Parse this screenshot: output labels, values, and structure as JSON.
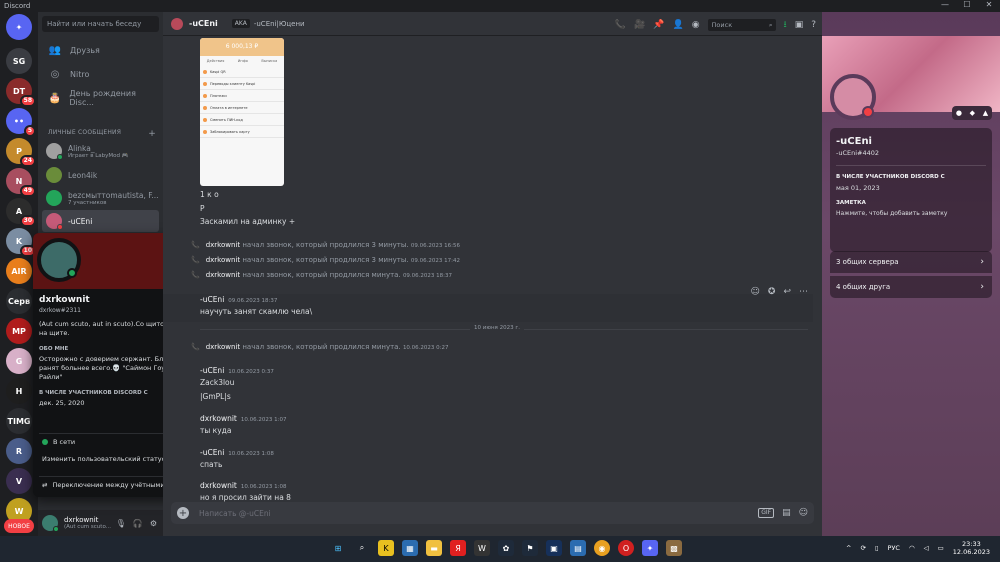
{
  "window": {
    "title": "Discord",
    "minimize": "—",
    "maximize": "☐",
    "close": "✕"
  },
  "rail": {
    "servers": [
      {
        "label": "✦",
        "color": "#5865f2",
        "badge": ""
      },
      {
        "label": "SG",
        "color": "#3a3c42",
        "badge": ""
      },
      {
        "label": "DT",
        "color": "#8a2b2b",
        "badge": "58"
      },
      {
        "label": "••",
        "color": "#5865f2",
        "badge": "5"
      },
      {
        "label": "P",
        "color": "#c48a2c",
        "badge": "24"
      },
      {
        "label": "N",
        "color": "#a84e5f",
        "badge": "49"
      },
      {
        "label": "A",
        "color": "#2c2c2c",
        "badge": "30"
      },
      {
        "label": "K",
        "color": "#7b8da2",
        "badge": "10"
      },
      {
        "label": "AIR",
        "color": "#e87e1c",
        "badge": ""
      },
      {
        "label": "Серв",
        "color": "#2b2d31",
        "badge": ""
      },
      {
        "label": "MP",
        "color": "#b01c1c",
        "badge": ""
      },
      {
        "label": "G",
        "color": "#d8b0c8",
        "badge": ""
      },
      {
        "label": "H",
        "color": "#1e1e1e",
        "badge": ""
      },
      {
        "label": "TIMG",
        "color": "#2b2d31",
        "badge": ""
      },
      {
        "label": "R",
        "color": "#4a5d8a",
        "badge": ""
      },
      {
        "label": "V",
        "color": "#3a2e50",
        "badge": ""
      },
      {
        "label": "W",
        "color": "#c0a020",
        "badge": ""
      }
    ],
    "new_label": "НОВОЕ"
  },
  "sidebar": {
    "search_label": "Найти или начать беседу",
    "nav": [
      {
        "label": "Друзья",
        "icon": "👥"
      },
      {
        "label": "Nitro",
        "icon": "◎"
      },
      {
        "label": "День рождения Disc...",
        "icon": "🎂"
      }
    ],
    "dm_header": "ЛИЧНЫЕ СООБЩЕНИЯ",
    "dm_add": "+",
    "dms": [
      {
        "name": "Alinka_",
        "sub": "Играет в LabyMod 🎮",
        "color": "#a0a0a0"
      },
      {
        "name": "Leon4ik",
        "sub": "",
        "color": "#6a8c3a"
      },
      {
        "name": "bezсмыттоmautista, F...",
        "sub": "7 участников",
        "color": "#23a55a"
      },
      {
        "name": "-uCEni",
        "sub": "",
        "color": "#c55a78"
      }
    ]
  },
  "user_panel": {
    "name": "dxrkownit",
    "status": "(Aut cum scuto..."
  },
  "popout": {
    "name": "dxrkownit",
    "tag": "dxrkow#2311",
    "bio": "(Aut cum scuto, aut in scuto).Со щитом или на щите.",
    "about_title": "ОБО МНЕ",
    "about_text": "Осторожно с доверием сержант. Близкие ранят больнее всего.💀 \"Саймон Гоуст Райли\"",
    "member_title": "В ЧИСЛЕ УЧАСТНИКОВ DISCORD С",
    "member_since": "дек. 25, 2020",
    "status_label": "В сети",
    "custom_status": "Изменить пользовательский статус",
    "switch_accounts": "Переключение между учётными ...",
    "arrow": "›"
  },
  "chat": {
    "header_name": "-uCEni",
    "aka_label": "AKA",
    "aka_name": "-uCEni|Юцени",
    "search_placeholder": "Поиск",
    "phone_card": {
      "balance": "6 000,13 ₽",
      "tabs": [
        "Действия",
        "Инфо",
        "Выписка"
      ],
      "lines": [
        "Kaspi QR",
        "Переводы клиенту Kaspi",
        "Платежи",
        "Оплата в интернете",
        "Сменить ПИН-код",
        "Заблокировать карту"
      ]
    },
    "lines": [
      {
        "text": "1 к о"
      },
      {
        "text": "Р"
      },
      {
        "text": "Заскамил на админку +"
      }
    ],
    "calls": [
      {
        "user": "dxrkownit",
        "text": "начал звонок, который продлился 3 минуты.",
        "ts": "09.06.2023 16:56"
      },
      {
        "user": "dxrkownit",
        "text": "начал звонок, который продлился 3 минуты.",
        "ts": "09.06.2023 17:42"
      },
      {
        "user": "dxrkownit",
        "text": "начал звонок, который продлился минута.",
        "ts": "09.06.2023 18:37"
      }
    ],
    "msg1": {
      "author": "-uCEni",
      "ts": "09.06.2023 18:37",
      "text": "научуть занят скамлю чела\\"
    },
    "date_divider": "10 июня 2023 г.",
    "call4": {
      "user": "dxrkownit",
      "text": "начал звонок, который продлился минута.",
      "ts": "10.06.2023 0:27"
    },
    "msg2": {
      "author": "-uCEni",
      "ts": "10.06.2023 0:37",
      "line1": "Zack3lou",
      "line2": "|GmPL|s"
    },
    "msg3": {
      "author": "dxrkownit",
      "ts": "10.06.2023 1:07",
      "text": "ты куда"
    },
    "msg4": {
      "author": "-uCEni",
      "ts": "10.06.2023 1:08",
      "text": "спать"
    },
    "msg5": {
      "author": "dxrkownit",
      "ts": "10.06.2023 1:08",
      "text": "но я просил зайти на 8"
    },
    "composer_placeholder": "Написать @-uCEni",
    "gif_label": "GIF"
  },
  "profile": {
    "name": "-uCEni",
    "tag": "-uCEni#4402",
    "member_title": "В ЧИСЛЕ УЧАСТНИКОВ DISCORD С",
    "member_since": "мая 01, 2023",
    "note_title": "ЗАМЕТКА",
    "note_placeholder": "Нажмите, чтобы добавить заметку",
    "mutual_servers": "3 общих сервера",
    "mutual_friends": "4 общих друга",
    "arrow": "›"
  },
  "taskbar": {
    "lang": "РУС",
    "time": "23:33",
    "date": "12.06.2023"
  }
}
